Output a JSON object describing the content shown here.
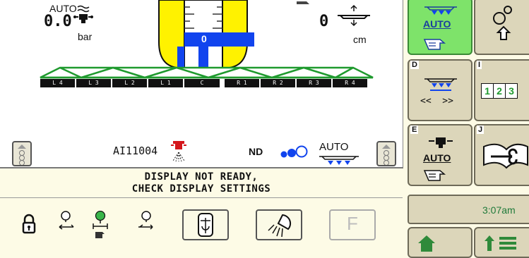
{
  "pressure": {
    "mode": "AUTO",
    "value": "0.0",
    "unit": "bar"
  },
  "height": {
    "value": "0",
    "unit": "cm"
  },
  "center_gauge": {
    "value": "0"
  },
  "sections": [
    "L 4",
    "L 3",
    "L 2",
    "L 1",
    "C",
    "R 1",
    "R 2",
    "R 3",
    "R 4"
  ],
  "nozzle": {
    "name": "AI11004"
  },
  "nd": {
    "label": "ND"
  },
  "boom_mode": {
    "label": "AUTO"
  },
  "message": {
    "line1": "DISPLAY NOT READY,",
    "line2": "CHECK DISPLAY SETTINGS"
  },
  "sidebar": {
    "auto_label_top": "AUTO",
    "d_letter": "D",
    "i_letter": "I",
    "nav_label": "<<  >>",
    "numbers": [
      "1",
      "2",
      "3"
    ],
    "e_letter": "E",
    "j_letter": "J",
    "auto_label_e": "AUTO",
    "time": "3:07am"
  },
  "bottom": {
    "f_label": "F"
  },
  "colors": {
    "accent_green": "#39b54a",
    "active_softkey": "#7ee36a",
    "boom_green": "#1f9a2e",
    "gauge_blue": "#1144ee",
    "gauge_yellow": "#fff000"
  }
}
